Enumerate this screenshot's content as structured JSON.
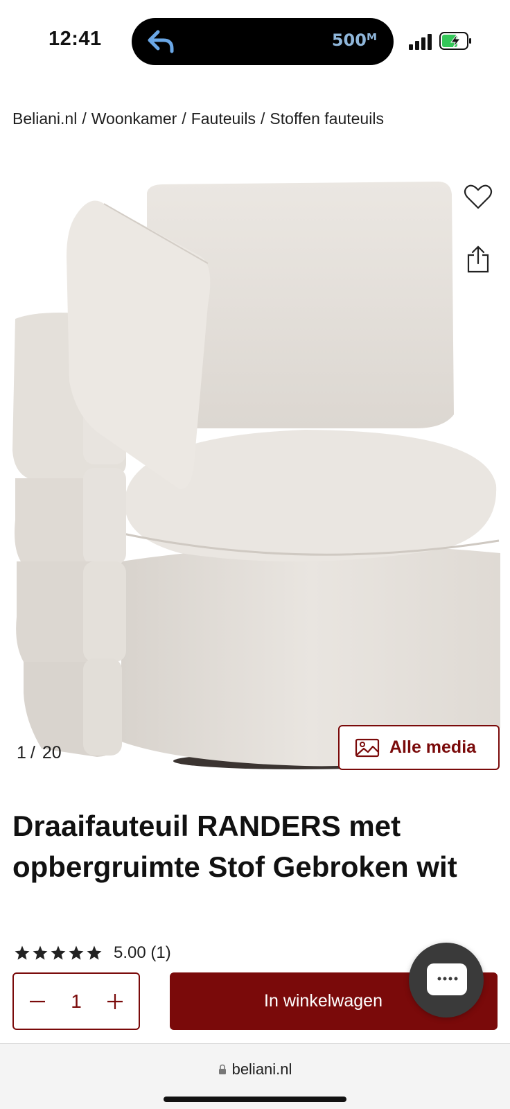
{
  "status_bar": {
    "time": "12:41",
    "speed": "500ᴹ",
    "back_icon": "back-arrow-icon",
    "signal_icon": "cellular-signal-icon",
    "battery_icon": "battery-charging-icon"
  },
  "breadcrumb": {
    "items": [
      "Beliani.nl",
      "Woonkamer",
      "Fauteuils",
      "Stoffen fauteuils"
    ],
    "separator": "/"
  },
  "gallery": {
    "current": "1",
    "separator": "/",
    "total": "20",
    "alle_media_label": "Alle media",
    "favorite_icon": "heart-icon",
    "share_icon": "share-icon",
    "media_icon": "image-icon"
  },
  "product": {
    "title": "Draaifauteuil RANDERS met opbergruimte Stof Gebroken wit",
    "rating": 5,
    "rating_text": "5.00 (1)"
  },
  "purchase": {
    "quantity": "1",
    "cart_label": "In winkelwagen"
  },
  "browser": {
    "url": "beliani.nl"
  },
  "colors": {
    "brand": "#7a0a0a",
    "chat": "#3a3a3a",
    "text": "#111111"
  }
}
